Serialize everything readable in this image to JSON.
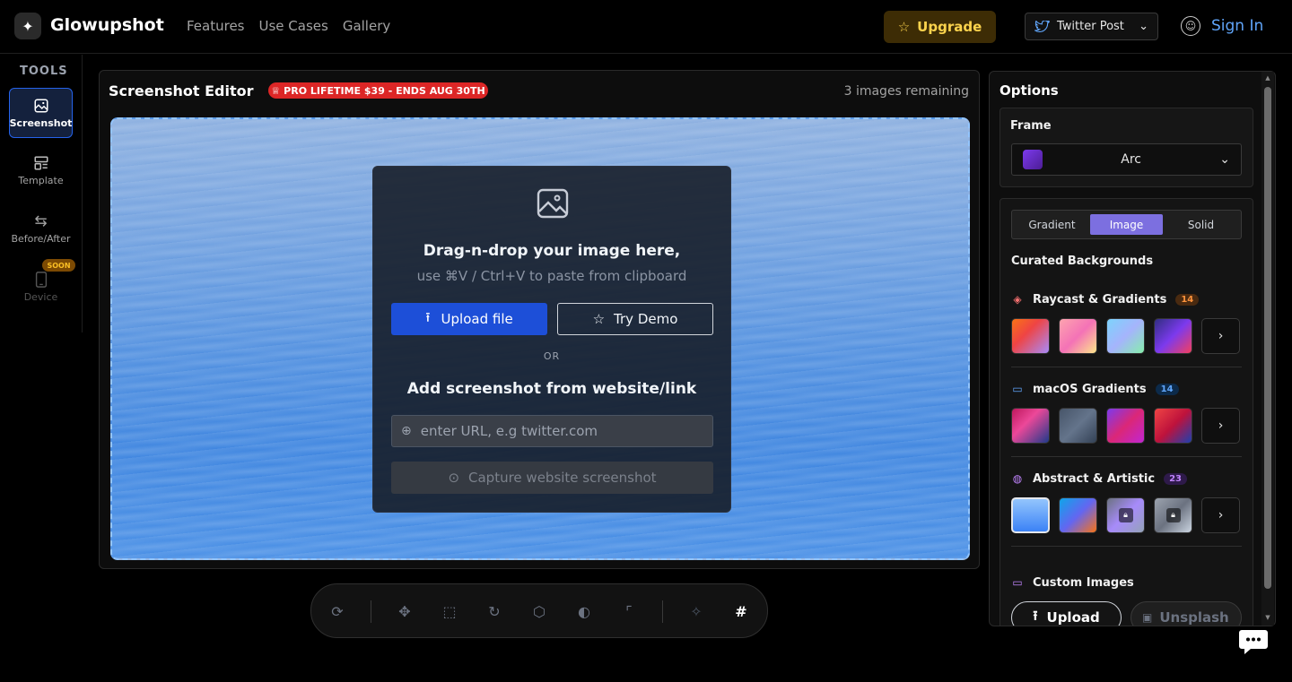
{
  "header": {
    "brand": "Glowupshot",
    "nav": [
      "Features",
      "Use Cases",
      "Gallery"
    ],
    "upgrade_label": "Upgrade",
    "post_type": "Twitter Post",
    "sign_in": "Sign In"
  },
  "sidebar": {
    "heading": "TOOLS",
    "items": [
      {
        "label": "Screenshot",
        "icon": "image-icon",
        "active": true
      },
      {
        "label": "Template",
        "icon": "template-icon"
      },
      {
        "label": "Before/After",
        "icon": "swap-icon"
      },
      {
        "label": "Device",
        "icon": "phone-icon",
        "badge": "SOON"
      }
    ]
  },
  "editor": {
    "title": "Screenshot Editor",
    "promo": "PRO LIFETIME $39 - ENDS AUG 30TH",
    "remaining": "3 images remaining",
    "drop_title": "Drag-n-drop your image here,",
    "drop_subtitle": "use ⌘V / Ctrl+V to paste from clipboard",
    "upload_label": "Upload file",
    "demo_label": "Try Demo",
    "or_label": "OR",
    "link_title": "Add screenshot from website/link",
    "url_placeholder": "enter URL, e.g twitter.com",
    "capture_label": "Capture website screenshot"
  },
  "toolbar": {
    "icons": [
      "reset-icon",
      "move-icon",
      "scale-icon",
      "rotate-icon",
      "3d-rotate-icon",
      "contrast-icon",
      "corner-icon",
      "magic-icon",
      "crop-icon"
    ]
  },
  "options": {
    "title": "Options",
    "frame_label": "Frame",
    "frame_value": "Arc",
    "bg_tabs": [
      "Gradient",
      "Image",
      "Solid"
    ],
    "bg_active": "Image",
    "curated_label": "Curated Backgrounds",
    "sections": [
      {
        "name": "Raycast & Gradients",
        "count": "14",
        "color": "#f87171"
      },
      {
        "name": "macOS Gradients",
        "count": "14",
        "color": "#60a5fa"
      },
      {
        "name": "Abstract & Artistic",
        "count": "23",
        "color": "#c084fc"
      }
    ],
    "custom_label": "Custom Images",
    "upload_label": "Upload",
    "unsplash_label": "Unsplash"
  }
}
